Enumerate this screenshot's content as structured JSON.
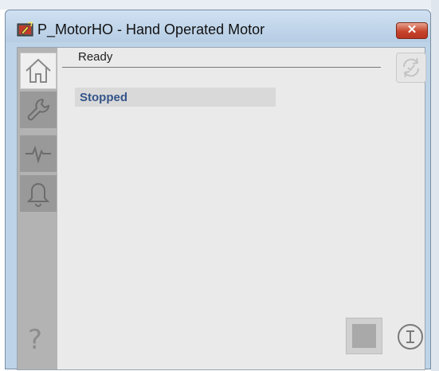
{
  "window": {
    "title": "P_MotorHO - Hand Operated Motor",
    "close_label": "✕"
  },
  "sidebar": {
    "items": [
      {
        "name": "home",
        "icon": "home-icon",
        "selected": true
      },
      {
        "name": "maintenance",
        "icon": "wrench-icon",
        "selected": false
      },
      {
        "name": "trends",
        "icon": "trend-icon",
        "selected": false
      },
      {
        "name": "alarms",
        "icon": "bell-icon",
        "selected": false
      }
    ],
    "help_label": "?"
  },
  "main": {
    "status": "Ready",
    "state": "Stopped"
  },
  "colors": {
    "state_text": "#34548a",
    "close_button": "#c7432b",
    "sidebar": "#b3b3b3"
  }
}
